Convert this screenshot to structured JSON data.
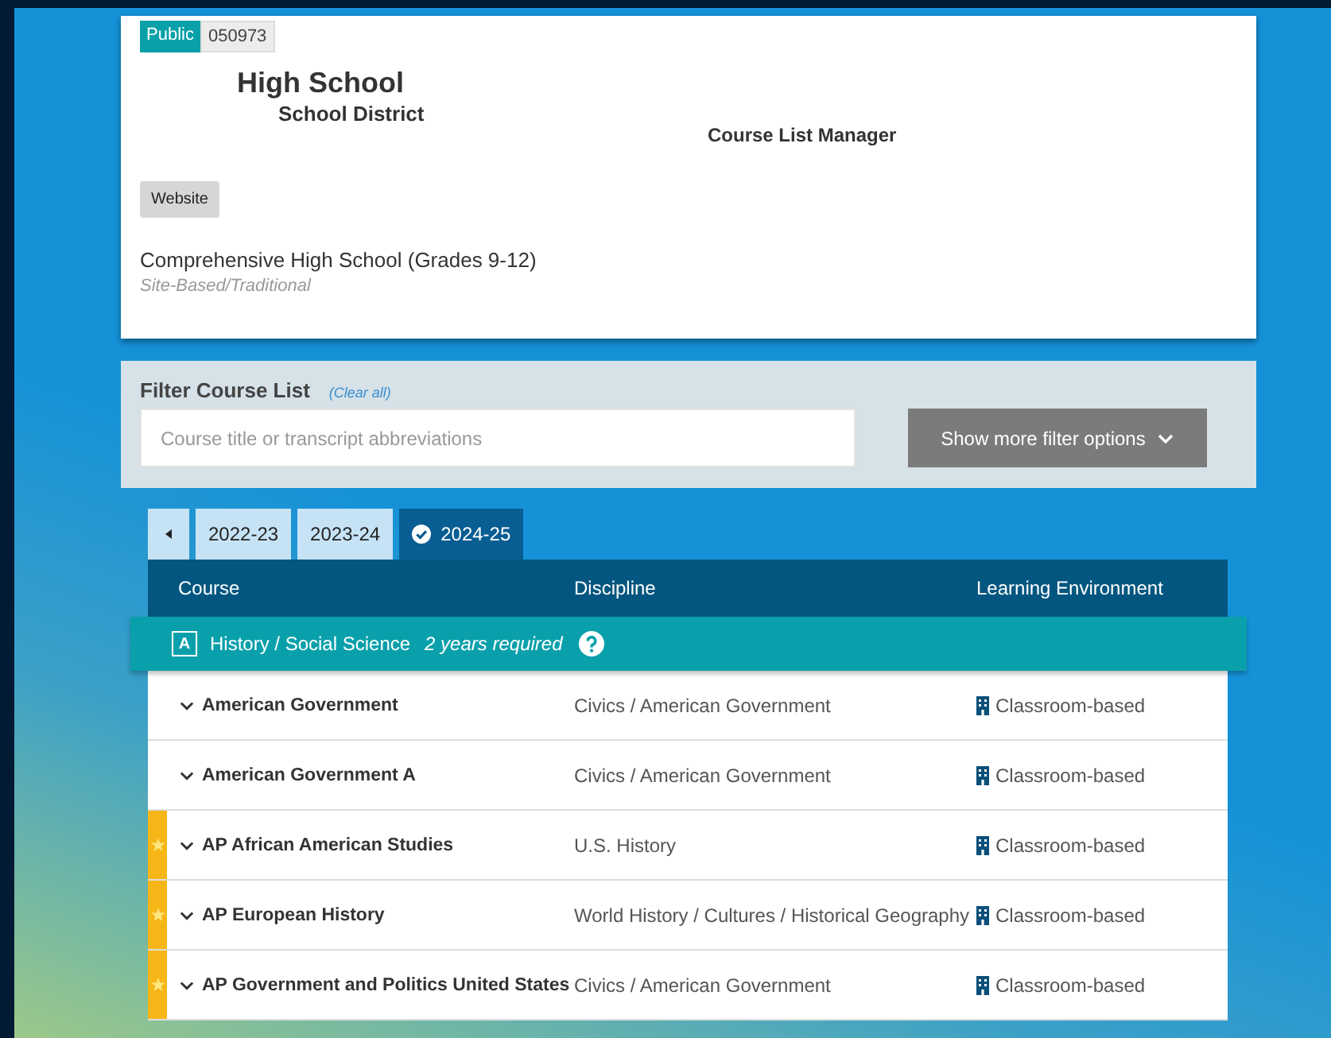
{
  "school": {
    "sector": "Public",
    "code": "050973",
    "name": "High School",
    "district": "School District",
    "app_title": "Course List Manager",
    "website_button": "Website",
    "school_type": "Comprehensive High School (Grades 9-12)",
    "school_model": "Site-Based/Traditional"
  },
  "filter": {
    "label": "Filter Course List",
    "clear_link": "(Clear all)",
    "search": {
      "placeholder": "Course title or transcript abbreviations"
    },
    "more_button": "Show more filter options"
  },
  "year_tabs": [
    {
      "label": "2022-23",
      "selected": false
    },
    {
      "label": "2023-24",
      "selected": false
    },
    {
      "label": "2024-25",
      "selected": true
    }
  ],
  "table": {
    "columns": [
      "Course",
      "Discipline",
      "Learning Environment"
    ],
    "group": {
      "letter": "A",
      "name": "History / Social Science",
      "requirement": "2 years required"
    },
    "rows": [
      {
        "course": "American Government",
        "discipline": "Civics / American Government",
        "environment": "Classroom-based",
        "starred": false
      },
      {
        "course": "American Government A",
        "discipline": "Civics / American Government",
        "environment": "Classroom-based",
        "starred": false
      },
      {
        "course": "AP African American Studies",
        "discipline": "U.S. History",
        "environment": "Classroom-based",
        "starred": true
      },
      {
        "course": "AP European History",
        "discipline": "World History / Cultures / Historical Geography",
        "environment": "Classroom-based",
        "starred": true
      },
      {
        "course": "AP Government and Politics United States",
        "discipline": "Civics / American Government",
        "environment": "Classroom-based",
        "starred": true
      }
    ]
  }
}
